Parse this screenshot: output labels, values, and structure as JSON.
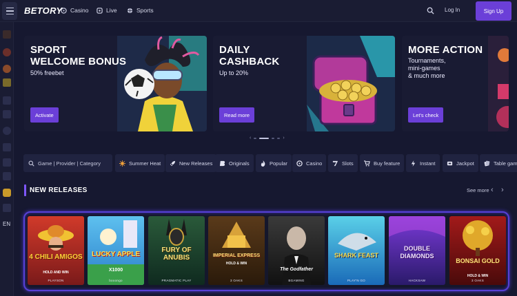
{
  "header": {
    "logo": "BETORY",
    "nav": [
      {
        "label": "Casino",
        "icon": "casino-icon"
      },
      {
        "label": "Live",
        "icon": "live-icon"
      },
      {
        "label": "Sports",
        "icon": "sports-icon"
      }
    ],
    "login_label": "Log In",
    "signup_label": "Sign Up"
  },
  "sidebar": {
    "icons": [
      "flame-icon",
      "fire-icon",
      "basketball-icon",
      "trophy-icon",
      "dice-icon",
      "cards-icon",
      "chip-icon",
      "gift-icon",
      "crown-icon",
      "users-icon",
      "coin-icon",
      "chat-icon"
    ],
    "language": "EN"
  },
  "banners": [
    {
      "title": "SPORT\nWELCOME BONUS",
      "subtitle": "50% freebet",
      "cta": "Activate"
    },
    {
      "title": "DAILY\nCASHBACK",
      "subtitle": "Up to 20%",
      "cta": "Read more"
    },
    {
      "title": "MORE ACTION",
      "subtitle": "Tournaments,\nmini-games\n& much more",
      "cta": "Let's check"
    }
  ],
  "search": {
    "placeholder": "Game | Provider | Category"
  },
  "filters": [
    {
      "label": "Summer Heat",
      "icon": "sun-icon"
    },
    {
      "label": "New Releases",
      "icon": "rocket-icon"
    },
    {
      "label": "Originals",
      "icon": "originals-icon"
    },
    {
      "label": "Popular",
      "icon": "flame-icon"
    },
    {
      "label": "Casino",
      "icon": "casino-icon"
    },
    {
      "label": "Slots",
      "icon": "seven-icon"
    },
    {
      "label": "Buy feature",
      "icon": "cart-icon"
    },
    {
      "label": "Instant",
      "icon": "lightning-icon"
    },
    {
      "label": "Jackpot",
      "icon": "jackpot-icon"
    },
    {
      "label": "Table game",
      "icon": "table-icon"
    }
  ],
  "section": {
    "title": "NEW RELEASES",
    "see_more": "See more"
  },
  "games": [
    {
      "name": "4 CHILI AMIGOS",
      "tag": "HOLD AND WIN",
      "provider": "PLAYSON"
    },
    {
      "name": "LUCKY APPLE",
      "tag": "X1000",
      "provider": "booongo"
    },
    {
      "name": "FURY OF ANUBIS",
      "tag": "",
      "provider": "PRAGMATIC PLAY"
    },
    {
      "name": "IMPERIAL EXPRESS",
      "tag": "HOLD & WIN",
      "provider": "3 OAKS"
    },
    {
      "name": "The Godfather",
      "tag": "",
      "provider": "BGAMING"
    },
    {
      "name": "SHARK FEAST",
      "tag": "",
      "provider": "PLAY'N GO"
    },
    {
      "name": "DOUBLE DIAMONDS",
      "tag": "",
      "provider": "HACKSAW"
    },
    {
      "name": "BONSAI GOLD",
      "tag": "HOLD & WIN",
      "provider": "3 OAKS"
    }
  ],
  "colors": {
    "accent": "#6b3fd8",
    "background": "#161830",
    "frame": "#5740d6"
  }
}
